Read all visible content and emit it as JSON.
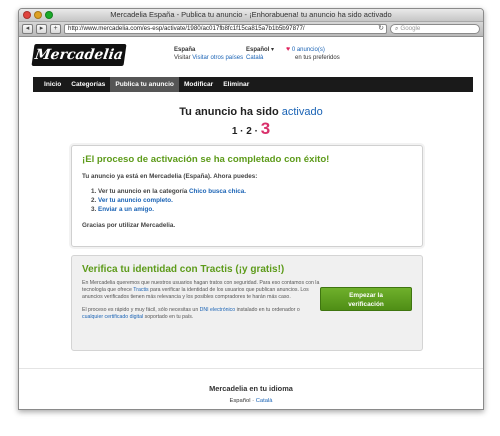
{
  "window": {
    "title": "Mercadelia España - Publica tu anuncio - ¡Enhorabuena! tu anuncio ha sido activado"
  },
  "toolbar": {
    "back": "◂",
    "forward": "▸",
    "add": "+",
    "url": "http://www.mercadelia.com/es-esp/activate/1980/ac017fb8fc1f15ca815a7b1b5b97877/",
    "refresh": "↻",
    "search_placeholder": "Google"
  },
  "header": {
    "logo_text": "Mercadelia",
    "country_label": "España",
    "country_link": "Visitar otros países",
    "language_label": "Español",
    "language_link": "Català",
    "favorites_link": "0 anuncio(s)",
    "favorites_suffix": "en tus preferidos"
  },
  "nav": {
    "items": [
      "Inicio",
      "Categorías",
      "Publica tu anuncio",
      "Modificar",
      "Eliminar"
    ]
  },
  "status": {
    "title_prefix": "Tu anuncio ha sido",
    "title_highlight": "activado",
    "steps_prefix": "1 · 2 ·",
    "current_step": "3"
  },
  "success_box": {
    "heading": "¡El proceso de activación se ha completado con éxito!",
    "intro": "Tu anuncio ya está en Mercadelia (España). Ahora puedes:",
    "item1_prefix": "Ver tu anuncio en la categoría",
    "item1_link": "Chico busca chica.",
    "item2_link": "Ver tu anuncio completo.",
    "item3_link": "Enviar a un amigo.",
    "thanks": "Gracias por utilizar Mercadelia."
  },
  "tractis_box": {
    "heading": "Verifica tu identidad con Tractis (¡y gratis!)",
    "para1_a": "En Mercadelia queremos que nuestros usuarios hagan tratos con seguridad. Para eso contamos con la tecnología que ofrece",
    "para1_link": "Tractis",
    "para1_b": "para verificar la identidad de los usuarios que publican anuncios. Los anuncios verificados tienen más relevancia y los posibles compradores te harán más caso.",
    "para2_a": "El proceso es rápido y muy fácil, sólo necesitas un",
    "para2_link1": "DNI electrónico",
    "para2_b": "instalado en tu ordenador o",
    "para2_link2": "cualquier certificado digital",
    "para2_c": "soportado en tu país.",
    "button_line1": "Empezar la",
    "button_line2": "verificación"
  },
  "footer": {
    "title": "Mercadelia en tu idioma",
    "lang1": "Español",
    "separator": "·",
    "lang2": "Català"
  },
  "colors": {
    "accent_green": "#5d9b1a",
    "link_blue": "#1a63b5",
    "step_pink": "#d9306b",
    "nav_bg": "#1a1a1a"
  }
}
